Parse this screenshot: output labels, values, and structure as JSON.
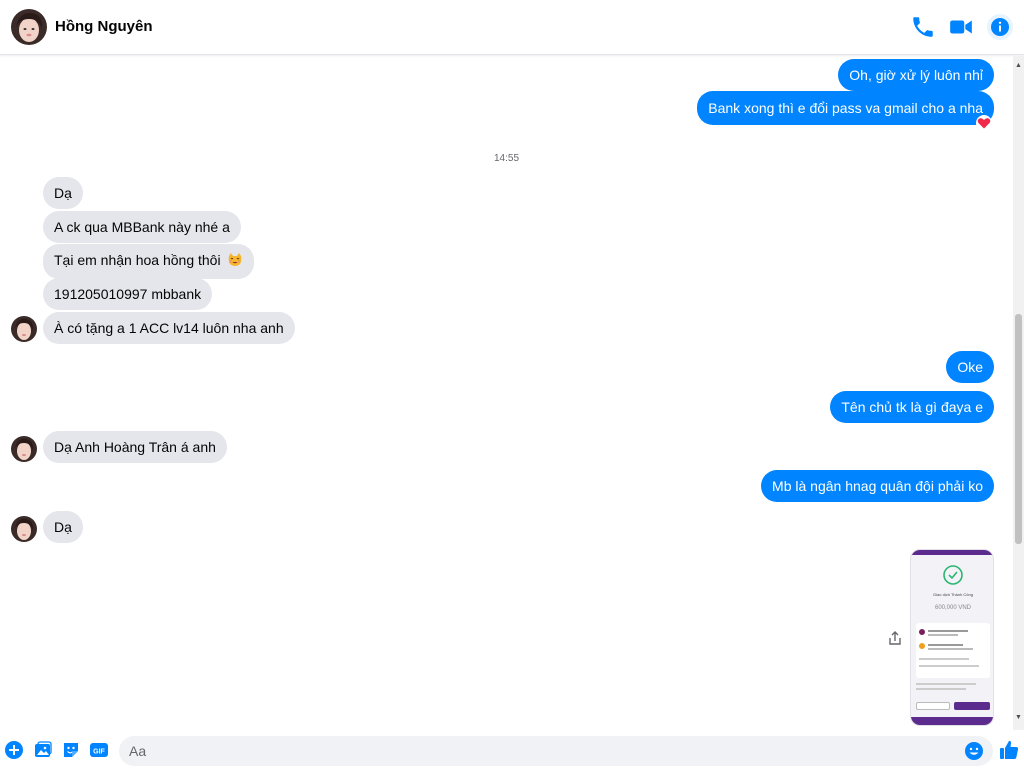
{
  "header": {
    "contact_name": "Hồng Nguyên",
    "icons": [
      "phone-icon",
      "video-camera-icon",
      "info-icon"
    ],
    "accent_color": "#0084ff"
  },
  "messages": {
    "out_1": "Oh, giờ xử lý luôn nhỉ",
    "out_2": "Bank xong thì e đổi pass va gmail cho a nha",
    "out_2_reaction": "heart",
    "timestamp": "14:55",
    "in_1": "Dạ",
    "in_2": "A ck qua MBBank này nhé a",
    "in_3": "Tại em nhận hoa hồng thôi",
    "in_4": "191205010997 mbbank",
    "in_5": "À có tặng a 1 ACC lv14 luôn nha anh",
    "out_3": "Oke",
    "out_4": "Tên chủ tk là gì đaya e",
    "in_6": "Dạ Anh Hoàng Trân á anh",
    "out_5": "Mb là ngân hnag quân đội phải ko",
    "in_7": "Dạ"
  },
  "receipt": {
    "title": "Giao dịch Thành Công",
    "amount": "600,000 VND",
    "icon": "check-circle-icon"
  },
  "composer": {
    "placeholder": "Aa",
    "icons": [
      "plus-icon",
      "image-icon",
      "sticker-icon",
      "gif-icon",
      "emoji-icon",
      "thumbs-up-icon"
    ]
  }
}
